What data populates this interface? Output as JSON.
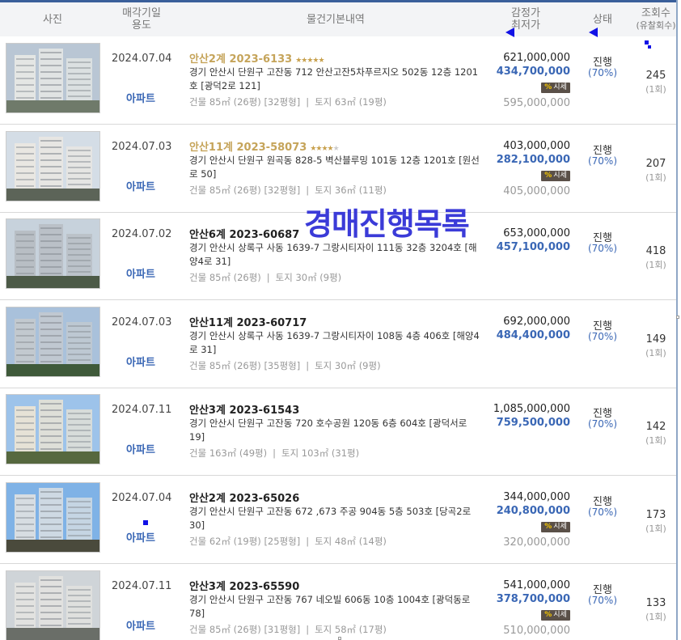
{
  "header": {
    "photo": "사진",
    "date_line1": "매각기일",
    "date_line2": "용도",
    "info": "물건기본내역",
    "price_line1": "감정가",
    "price_line2": "최저가",
    "status": "상태",
    "views_line1": "조회수",
    "views_line2": "(유찰회수)"
  },
  "overlay_text": "경매진행목록",
  "market_badge": {
    "icon": "%",
    "label": "시세"
  },
  "rows": [
    {
      "date": "2024.07.04",
      "usage": "아파트",
      "case": "안산2계 2023-6133",
      "stars": 5,
      "address": "경기 안산시 단원구 고잔동 712 안산고잔5차푸르지오 502동 12층 1201호 [광덕2로 121]",
      "building": "건물 85㎡ (26평) [32평형]",
      "land": "토지 63㎡ (19평)",
      "appraisal": "621,000,000",
      "minimum": "434,700,000",
      "has_market": true,
      "market": "595,000,000",
      "status": "진행",
      "pct": "(70%)",
      "views": "245",
      "fails": "(1회)"
    },
    {
      "date": "2024.07.03",
      "usage": "아파트",
      "case": "안산11계 2023-58073",
      "stars": 4,
      "address": "경기 안산시 단원구 원곡동 828-5 벽산블루밍 101동 12층 1201호 [원선로 50]",
      "building": "건물 85㎡ (26평) [32평형]",
      "land": "토지 36㎡ (11평)",
      "appraisal": "403,000,000",
      "minimum": "282,100,000",
      "has_market": true,
      "market": "405,000,000",
      "status": "진행",
      "pct": "(70%)",
      "views": "207",
      "fails": "(1회)"
    },
    {
      "date": "2024.07.02",
      "usage": "아파트",
      "case": "안산6계 2023-60687",
      "stars": 0,
      "address": "경기 안산시 상록구 사동 1639-7 그랑시티자이 111동 32층 3204호 [해양4로 31]",
      "building": "건물 85㎡ (26평)",
      "land": "토지 30㎡ (9평)",
      "appraisal": "653,000,000",
      "minimum": "457,100,000",
      "has_market": false,
      "market": "",
      "status": "진행",
      "pct": "(70%)",
      "views": "418",
      "fails": "(1회)"
    },
    {
      "date": "2024.07.03",
      "usage": "아파트",
      "case": "안산11계 2023-60717",
      "stars": 0,
      "address": "경기 안산시 상록구 사동 1639-7 그랑시티자이 108동 4층 406호 [해양4로 31]",
      "building": "건물 85㎡ (26평) [35평형]",
      "land": "토지 30㎡ (9평)",
      "appraisal": "692,000,000",
      "minimum": "484,400,000",
      "has_market": false,
      "market": "",
      "status": "진행",
      "pct": "(70%)",
      "views": "149",
      "fails": "(1회)"
    },
    {
      "date": "2024.07.11",
      "usage": "아파트",
      "case": "안산3계 2023-61543",
      "stars": 0,
      "address": "경기 안산시 단원구 고잔동 720 호수공원 120동 6층 604호 [광덕서로 19]",
      "building": "건물 163㎡ (49평)",
      "land": "토지 103㎡ (31평)",
      "appraisal": "1,085,000,000",
      "minimum": "759,500,000",
      "has_market": false,
      "market": "",
      "status": "진행",
      "pct": "(70%)",
      "views": "142",
      "fails": "(1회)"
    },
    {
      "date": "2024.07.04",
      "usage": "아파트",
      "case": "안산2계 2023-65026",
      "stars": 0,
      "address": "경기 안산시 단원구 고잔동 672 ,673 주공 904동 5층 503호 [당곡2로 30]",
      "building": "건물 62㎡ (19평) [25평형]",
      "land": "토지 48㎡ (14평)",
      "appraisal": "344,000,000",
      "minimum": "240,800,000",
      "has_market": true,
      "market": "320,000,000",
      "status": "진행",
      "pct": "(70%)",
      "views": "173",
      "fails": "(1회)"
    },
    {
      "date": "2024.07.11",
      "usage": "아파트",
      "case": "안산3계 2023-65590",
      "stars": 0,
      "address": "경기 안산시 단원구 고잔동 767 네오빌 606동 10층 1004호 [광덕동로 78]",
      "building": "건물 85㎡ (26평) [31평형]",
      "land": "토지 58㎡ (17평)",
      "appraisal": "541,000,000",
      "minimum": "378,700,000",
      "has_market": true,
      "market": "510,000,000",
      "status": "진행",
      "pct": "(70%)",
      "views": "133",
      "fails": "(1회)"
    }
  ]
}
